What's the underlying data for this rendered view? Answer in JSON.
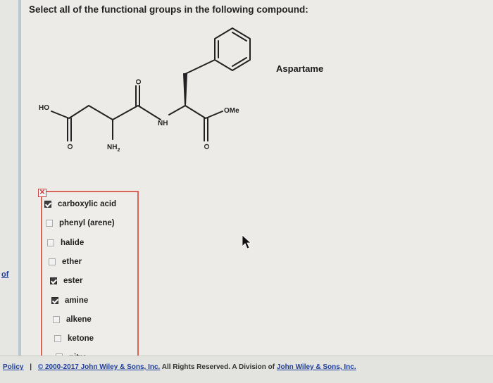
{
  "question": "Select all of the functional groups in the following compound:",
  "compound": {
    "name": "Aspartame",
    "labels": {
      "ho": "HO",
      "nh": "NH",
      "ome": "OMe",
      "nh2": "NH",
      "nh2_sub": "2",
      "o_top": "O",
      "o_left": "O",
      "o_right": "O"
    }
  },
  "sidebar": {
    "link": "of"
  },
  "answer_box": {
    "close_icon": "✕",
    "options": [
      {
        "label": "carboxylic acid",
        "checked": true
      },
      {
        "label": "phenyl (arene)",
        "checked": false
      },
      {
        "label": "halide",
        "checked": false
      },
      {
        "label": "ether",
        "checked": false
      },
      {
        "label": "ester",
        "checked": true
      },
      {
        "label": "amine",
        "checked": true
      },
      {
        "label": "alkene",
        "checked": false
      },
      {
        "label": "ketone",
        "checked": false
      },
      {
        "label": "nitro",
        "checked": false
      }
    ]
  },
  "footer": {
    "policy": "Policy",
    "separator": "|",
    "copyright": "© 2000-2017 John Wiley & Sons, Inc.",
    "rights": "All Rights Reserved. A Division of",
    "company": "John Wiley & Sons, Inc."
  }
}
